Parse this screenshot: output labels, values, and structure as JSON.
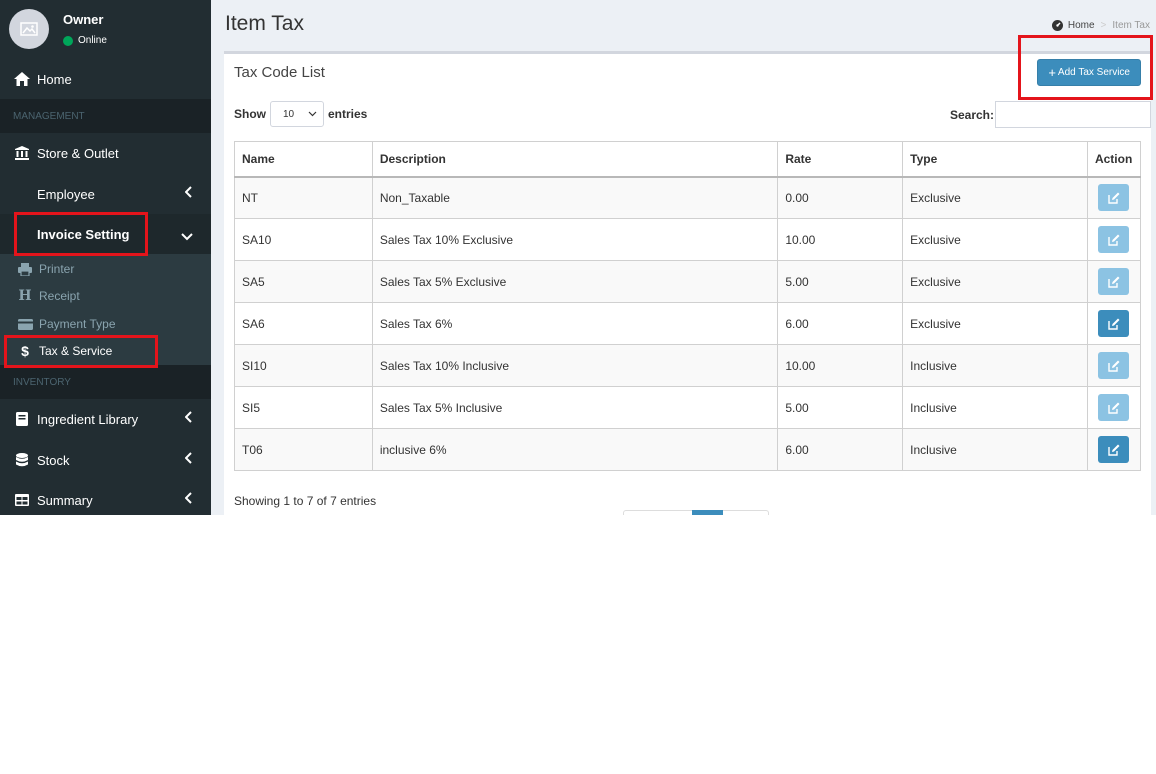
{
  "user": {
    "name": "Owner",
    "status": "Online"
  },
  "sidebar": {
    "home": "Home",
    "management_header": "MANAGEMENT",
    "items": [
      {
        "label": "Store & Outlet",
        "icon": "bank-icon"
      },
      {
        "label": "Employee"
      },
      {
        "label": "Invoice Setting"
      }
    ],
    "submenu": [
      {
        "label": "Printer",
        "icon": "printer-icon"
      },
      {
        "label": "Receipt",
        "icon": "heading-h-icon"
      },
      {
        "label": "Payment Type",
        "icon": "credit-card-icon"
      },
      {
        "label": "Tax & Service",
        "icon": "dollar-icon"
      }
    ],
    "inventory_header": "INVENTORY",
    "inventory_items": [
      {
        "label": "Ingredient Library",
        "icon": "book-icon"
      },
      {
        "label": "Stock",
        "icon": "database-icon"
      },
      {
        "label": "Summary",
        "icon": "table-icon"
      }
    ]
  },
  "page": {
    "title": "Item Tax",
    "breadcrumb": {
      "home": "Home",
      "separator": ">",
      "current": "Item Tax"
    }
  },
  "box": {
    "title": "Tax Code List",
    "add_button": "Add Tax Service",
    "length_prefix": "Show",
    "length_value": "10",
    "length_suffix": "entries",
    "search_label": "Search:",
    "search_value": "",
    "info": "Showing 1 to 7 of 7 entries"
  },
  "table": {
    "columns": [
      "Name",
      "Description",
      "Rate",
      "Type",
      "Action"
    ],
    "rows": [
      [
        "NT",
        "Non_Taxable",
        "0.00",
        "Exclusive"
      ],
      [
        "SA10",
        "Sales Tax 10% Exclusive",
        "10.00",
        "Exclusive"
      ],
      [
        "SA5",
        "Sales Tax 5% Exclusive",
        "5.00",
        "Exclusive"
      ],
      [
        "SA6",
        "Sales Tax 6%",
        "6.00",
        "Exclusive"
      ],
      [
        "SI10",
        "Sales Tax 10% Inclusive",
        "10.00",
        "Inclusive"
      ],
      [
        "SI5",
        "Sales Tax 5% Inclusive",
        "5.00",
        "Inclusive"
      ],
      [
        "T06",
        "inclusive 6%",
        "6.00",
        "Inclusive"
      ]
    ]
  },
  "colors": {
    "sidebar_bg": "#222d32",
    "primary": "#3c8dbc",
    "primary_light": "#8cc3e3",
    "highlight": "#e4141b",
    "online": "#00a65a"
  }
}
